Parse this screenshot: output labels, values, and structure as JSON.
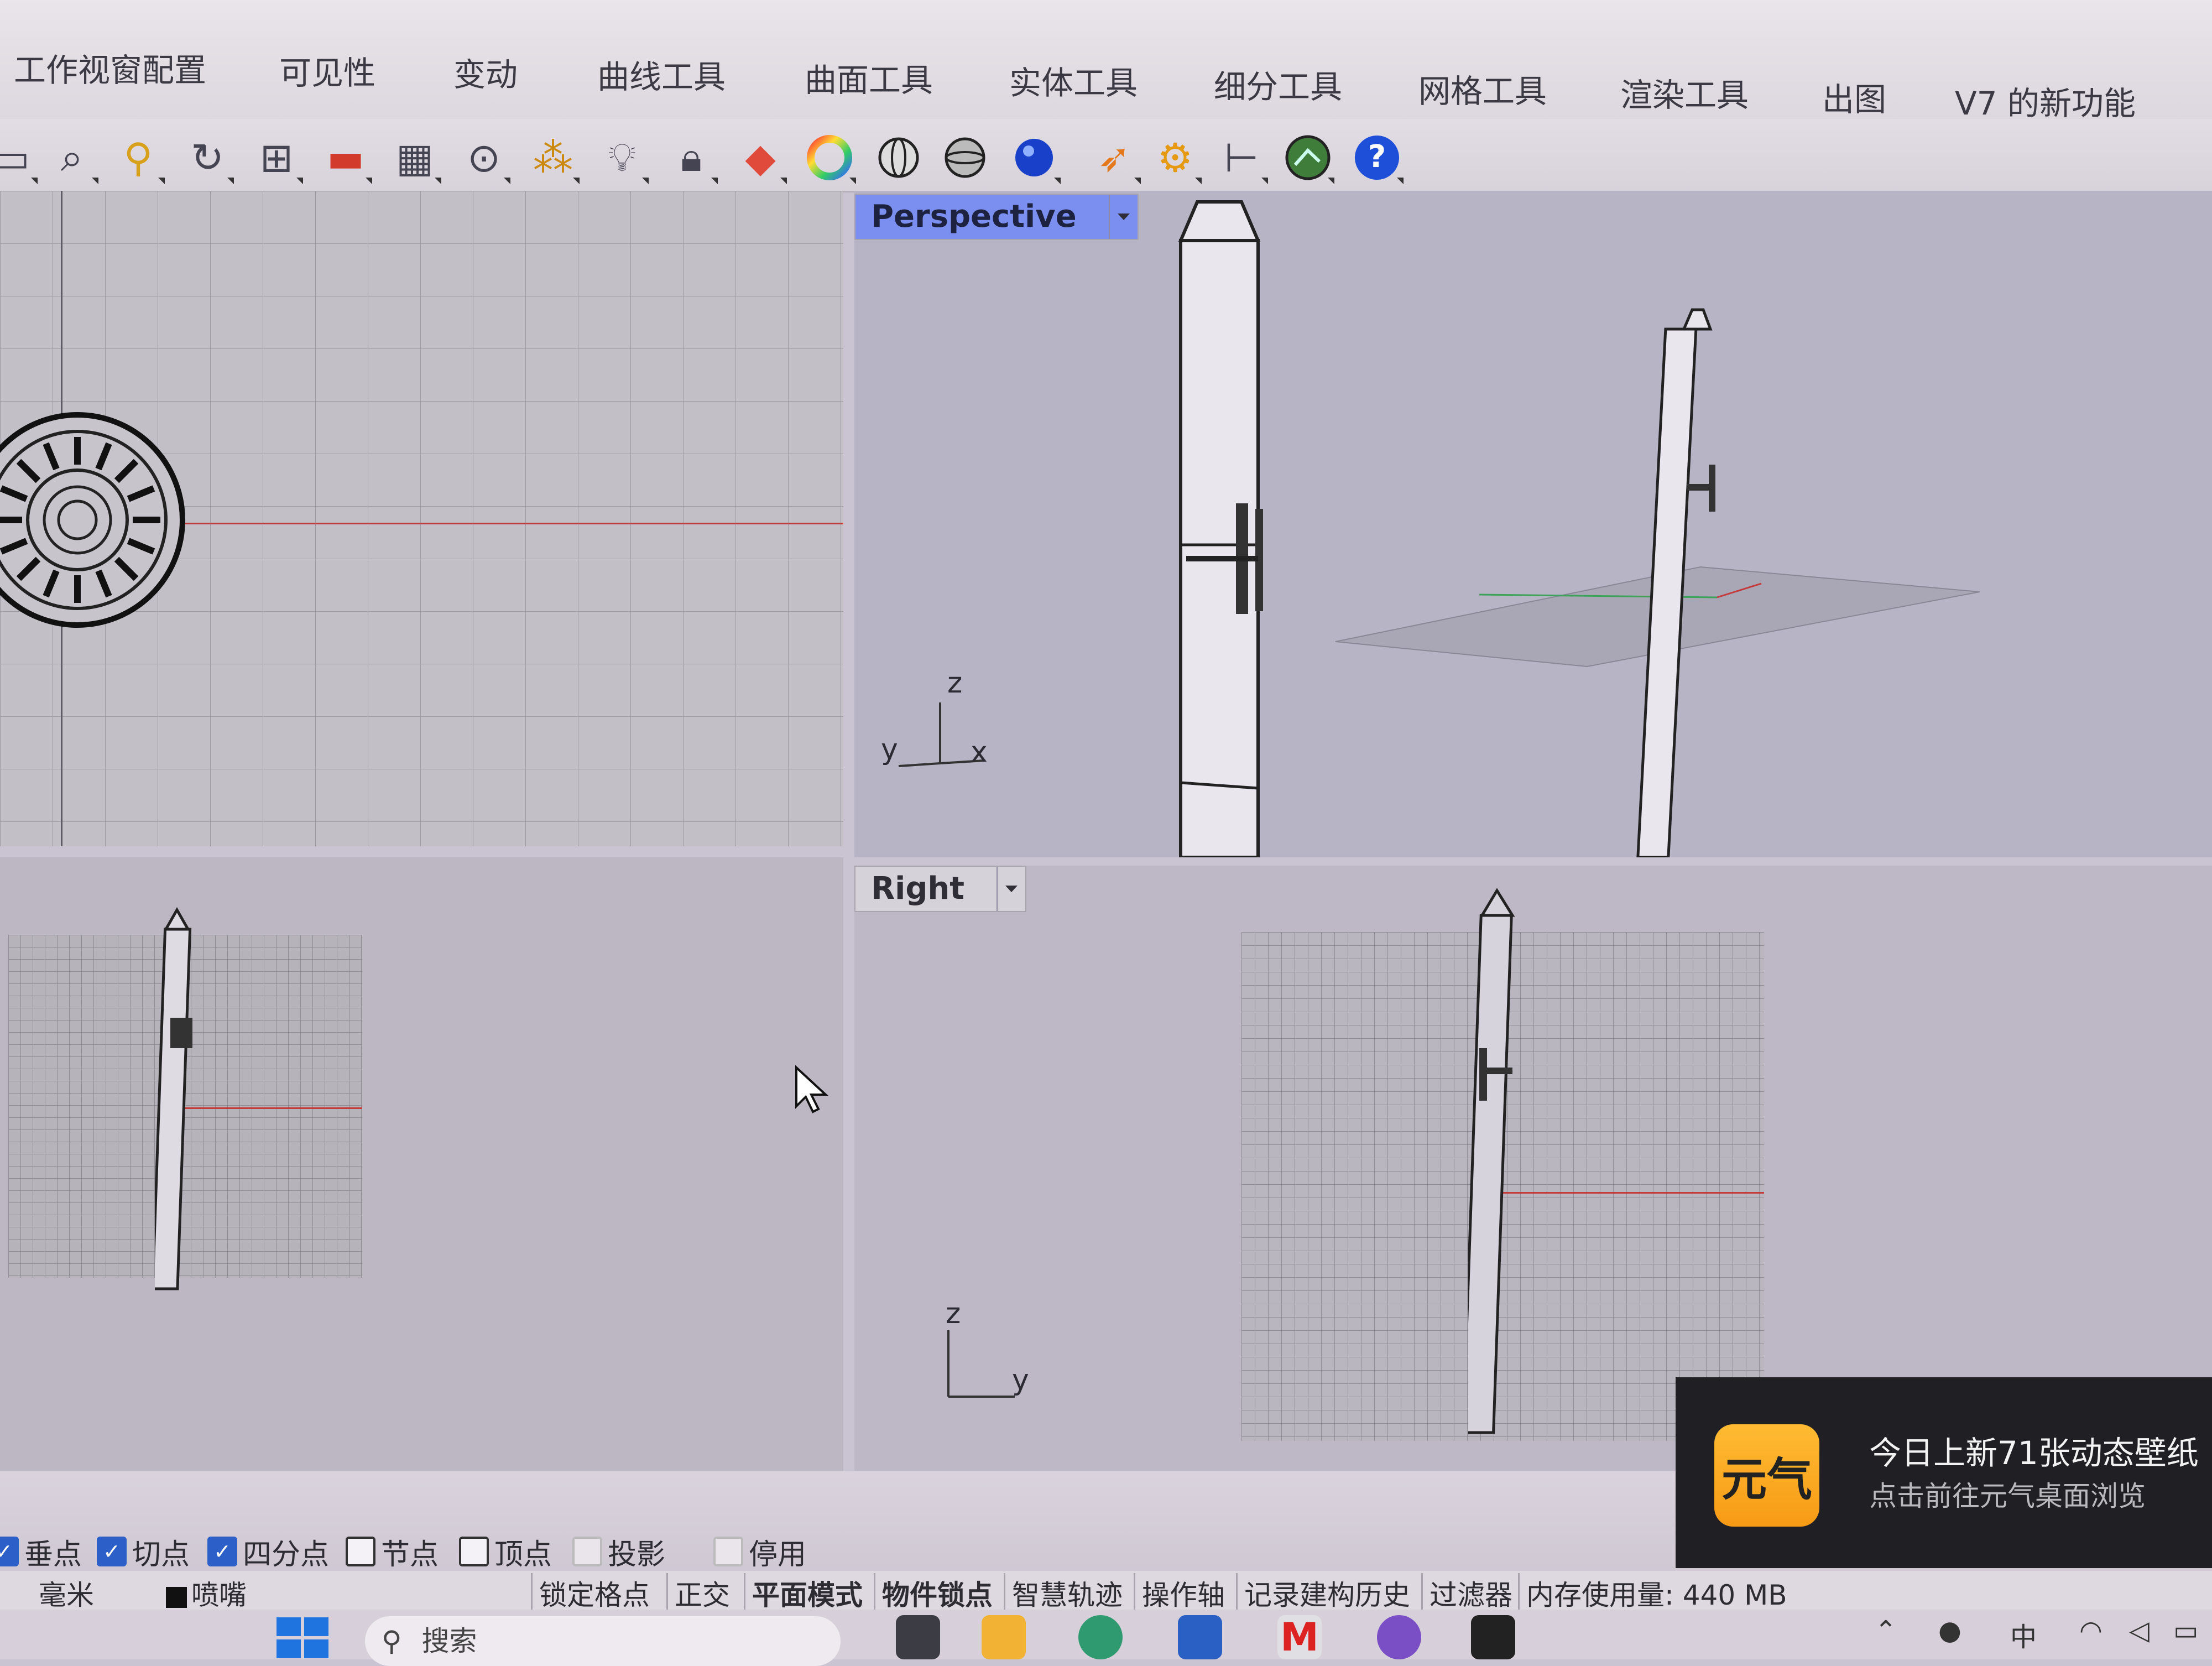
{
  "ribbon": {
    "tabs": [
      {
        "label": "工作视窗配置"
      },
      {
        "label": "可见性"
      },
      {
        "label": "变动"
      },
      {
        "label": "曲线工具"
      },
      {
        "label": "曲面工具"
      },
      {
        "label": "实体工具"
      },
      {
        "label": "细分工具"
      },
      {
        "label": "网格工具"
      },
      {
        "label": "渲染工具"
      },
      {
        "label": "出图"
      },
      {
        "label": "V7 的新功能"
      }
    ]
  },
  "toolbar": {
    "icons": [
      "zoom-window-icon",
      "zoom-extents-icon",
      "zoom-selected-icon",
      "rotate-view-icon",
      "four-viewports-icon",
      "car-icon",
      "construction-plane-icon",
      "circle-icon",
      "points-icon",
      "light-bulb-icon",
      "lock-icon",
      "layer-icon",
      "color-wheel-icon",
      "sphere-wire-icon",
      "sphere-shaded-icon",
      "render-sphere-icon",
      "select-arrow-icon",
      "gear-icon",
      "dimension-icon",
      "grasshopper-icon",
      "help-icon"
    ]
  },
  "viewports": {
    "perspective": {
      "label": "Perspective",
      "axis": {
        "z": "z",
        "y": "y",
        "x": "x"
      }
    },
    "right": {
      "label": "Right",
      "axis": {
        "z": "z",
        "y": "y"
      }
    }
  },
  "osnaps": [
    {
      "label": "垂点",
      "checked": true
    },
    {
      "label": "切点",
      "checked": true
    },
    {
      "label": "四分点",
      "checked": true
    },
    {
      "label": "节点",
      "checked": false
    },
    {
      "label": "顶点",
      "checked": false
    },
    {
      "label": "投影",
      "checked": false
    },
    {
      "label": "停用",
      "checked": false
    }
  ],
  "statusbar": {
    "units": "毫米",
    "layer": "喷嘴",
    "panes": [
      {
        "label": "锁定格点",
        "bold": false
      },
      {
        "label": "正交",
        "bold": false
      },
      {
        "label": "平面模式",
        "bold": true
      },
      {
        "label": "物件锁点",
        "bold": true
      },
      {
        "label": "智慧轨迹",
        "bold": false
      },
      {
        "label": "操作轴",
        "bold": false
      },
      {
        "label": "记录建构历史",
        "bold": false
      },
      {
        "label": "过滤器",
        "bold": false
      }
    ],
    "memory": "内存使用量: 440 MB"
  },
  "taskbar": {
    "search_placeholder": "搜索",
    "tray": {
      "ime": "中"
    }
  },
  "toast": {
    "logo_text": "元气",
    "title": "今日上新71张动态壁纸",
    "subtitle": "点击前往元气桌面浏览"
  },
  "colors": {
    "active_viewport_label": "#7b8ff0",
    "x_axis": "#c43b3b",
    "y_axis": "#3ea35a"
  }
}
